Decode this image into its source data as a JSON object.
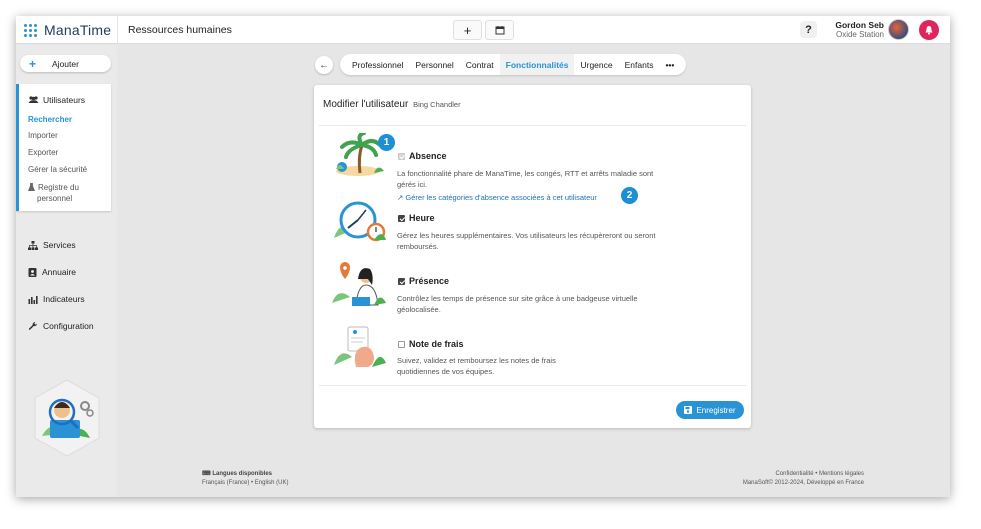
{
  "app": {
    "name": "ManaTime",
    "breadcrumb": "Ressources humaines"
  },
  "topbar": {
    "add_icon": "plus-icon",
    "calendar_icon": "calendar-icon",
    "help_label": "?",
    "user_name": "Gordon Seb",
    "user_company": "Oxide Station"
  },
  "sidebar": {
    "add_label": "Ajouter",
    "users_title": "Utilisateurs",
    "users_items": [
      "Rechercher",
      "Importer",
      "Exporter",
      "Gérer la sécurité",
      "Registre du personnel"
    ],
    "items": [
      "Services",
      "Annuaire",
      "Indicateurs",
      "Configuration"
    ]
  },
  "tabs": {
    "items": [
      "Professionnel",
      "Personnel",
      "Contrat",
      "Fonctionnalités",
      "Urgence",
      "Enfants"
    ],
    "active": "Fonctionnalités",
    "more_label": "•••"
  },
  "card": {
    "title": "Modifier l'utilisateur",
    "subtitle": "Bing Chandler",
    "features": [
      {
        "name": "Absence",
        "checked": true,
        "disabled": true,
        "desc": "La fonctionnalité phare de ManaTime, les congés, RTT et arrêts maladie sont gérés ici.",
        "link": "Gérer les catégories d'absence associées à cet utilisateur"
      },
      {
        "name": "Heure",
        "checked": true,
        "desc": "Gérez les heures supplémentaires. Vos utilisateurs les récupèreront ou seront remboursés."
      },
      {
        "name": "Présence",
        "checked": true,
        "desc": "Contrôlez les temps de présence sur site grâce à une badgeuse virtuelle géolocalisée."
      },
      {
        "name": "Note de frais",
        "checked": false,
        "desc": "Suivez, validez et remboursez les notes de frais quotidiennes de vos équipes."
      }
    ],
    "save_label": "Enregistrer",
    "badges": [
      "1",
      "2"
    ]
  },
  "footer": {
    "lang_title": "Langues disponibles",
    "lang_values": "Français (France) • English (UK)",
    "legal": "Confidentialité • Mentions légales",
    "copyright": "ManaSoft© 2012-2024, Développé en France"
  },
  "colors": {
    "accent": "#2a93d5",
    "notif": "#e0245e",
    "badge": "#1d8fd6"
  }
}
